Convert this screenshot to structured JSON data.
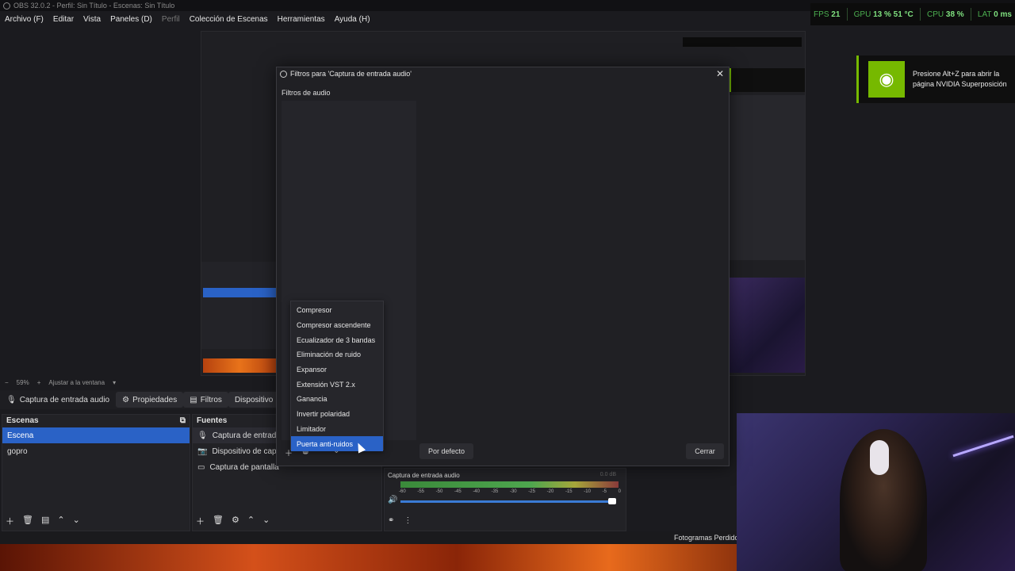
{
  "window": {
    "title": "OBS 32.0.2 - Perfil: Sin Título - Escenas: Sin Título"
  },
  "menu": {
    "items": [
      "Archivo (F)",
      "Editar",
      "Vista",
      "Paneles (D)",
      "Perfil",
      "Colección de Escenas",
      "Herramientas",
      "Ayuda (H)"
    ]
  },
  "perf": {
    "fps_label": "FPS",
    "fps": "21",
    "gpu_label": "GPU",
    "gpu": "13 %  51 °C",
    "cpu_label": "CPU",
    "cpu": "38 %",
    "lat_label": "LAT",
    "lat": "0 ms"
  },
  "nvidia": {
    "text": "Presione Alt+Z para abrir la página NVIDIA Superposición",
    "color": "#76b900"
  },
  "zoom": {
    "level": "59%",
    "fit": "Ajustar a la ventana"
  },
  "source_toolbar": {
    "source": "Captura de entrada audio",
    "properties": "Propiedades",
    "filters": "Filtros",
    "device": "Dispositivo"
  },
  "scenes": {
    "title": "Escenas",
    "items": [
      "Escena",
      "gopro"
    ],
    "selected": 0
  },
  "sources": {
    "title": "Fuentes",
    "items": [
      "Captura de entrada a",
      "Dispositivo de captur",
      "Captura de pantalla"
    ]
  },
  "dialog": {
    "title": "Filtros para 'Captura de entrada audio'",
    "subtitle": "Filtros de audio",
    "default_button": "Por defecto",
    "close_button": "Cerrar"
  },
  "filter_menu": {
    "items": [
      "Compresor",
      "Compresor ascendente",
      "Ecualizador de 3 bandas",
      "Eliminación de ruido",
      "Expansor",
      "Extensión VST 2.x",
      "Ganancia",
      "Invertir polaridad",
      "Limitador",
      "Puerta anti-ruidos"
    ],
    "highlighted": 9
  },
  "mixer": {
    "name": "Captura de entrada audio",
    "db": "0.0 dB",
    "ticks": [
      "-60",
      "-55",
      "-50",
      "-45",
      "-40",
      "-35",
      "-30",
      "-25",
      "-20",
      "-15",
      "-10",
      "-5",
      "0"
    ]
  },
  "status": {
    "dropped": "Fotogramas Perdido"
  }
}
